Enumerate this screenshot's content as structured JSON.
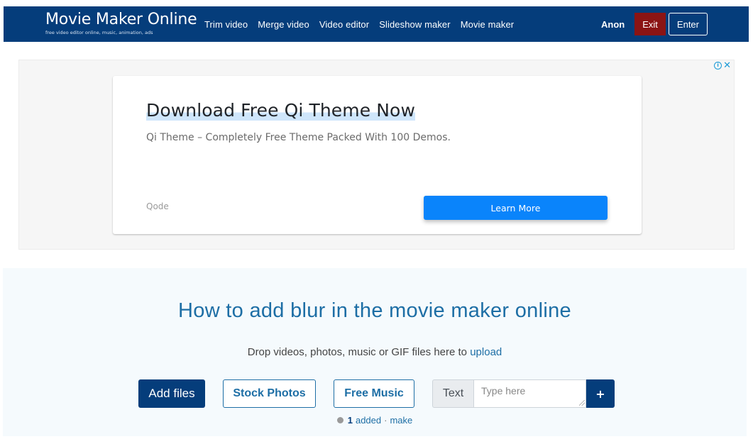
{
  "nav": {
    "brand_title": "Movie Maker Online",
    "brand_subtitle": "free video editor online, music, animation, ads",
    "links": [
      {
        "label": "Trim video"
      },
      {
        "label": "Merge video"
      },
      {
        "label": "Video editor"
      },
      {
        "label": "Slideshow maker"
      },
      {
        "label": "Movie maker"
      }
    ],
    "user_name": "Anon",
    "exit_label": "Exit",
    "enter_label": "Enter",
    "colors": {
      "navbar": "#053d7b",
      "exit": "#8b1414"
    }
  },
  "ad": {
    "info_icon": "i",
    "close_icon": "✕",
    "headline": "Download Free Qi Theme Now",
    "description": "Qi Theme – Completely Free Theme Packed With 100 Demos.",
    "advertiser": "Qode",
    "cta_label": "Learn More",
    "colors": {
      "cta": "#0a84fb"
    }
  },
  "main": {
    "title": "How to add blur in the movie maker online",
    "drop_text": "Drop videos, photos, music or GIF files here to ",
    "upload_link": "upload",
    "add_files_label": "Add files",
    "stock_photos_label": "Stock Photos",
    "free_music_label": "Free Music",
    "text_addon_label": "Text",
    "text_input_value": "",
    "text_input_placeholder": "Type here",
    "plus_label": "+",
    "status": {
      "count": "1",
      "added_label": "added",
      "separator": "·",
      "make_label": "make"
    },
    "colors": {
      "title": "#1d6ea5",
      "primary": "#053d7b"
    }
  }
}
